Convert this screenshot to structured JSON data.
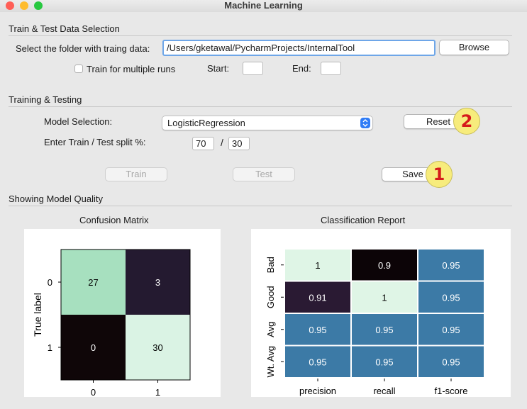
{
  "window": {
    "title": "Machine Learning"
  },
  "data_selection": {
    "section_title": "Train & Test Data Selection",
    "folder_label": "Select the folder with  traing data:",
    "folder_path": "/Users/gketawal/PycharmProjects/InternalTool",
    "browse_label": "Browse",
    "multi_runs_label": "Train for multiple runs",
    "multi_runs_checked": false,
    "start_label": "Start:",
    "start_value": "",
    "end_label": "End:",
    "end_value": ""
  },
  "training": {
    "section_title": "Training &  Testing",
    "model_label": "Model Selection:",
    "model_value": "LogisticRegression",
    "reset_label": "Reset",
    "split_label": "Enter Train / Test split %:",
    "train_split": "70",
    "split_separator": "/",
    "test_split": "30",
    "train_label": "Train",
    "test_label": "Test",
    "save_label": "Save"
  },
  "annotations": {
    "badge_1": "1",
    "badge_2": "2",
    "badge_color": "#f7ec7c",
    "badge_text_color": "#d61b1b"
  },
  "quality": {
    "section_title": "Showing Model Quality",
    "confusion": {
      "title": "Confusion Matrix",
      "ylabel": "True label",
      "row_labels": [
        "0",
        "1"
      ],
      "col_labels": [
        "0",
        "1"
      ],
      "cells": [
        [
          "27",
          "3"
        ],
        [
          "0",
          "30"
        ]
      ]
    },
    "report": {
      "title": "Classification Report",
      "row_labels": [
        "Bad",
        "Good",
        "Avg",
        "Wt. Avg"
      ],
      "col_labels": [
        "precision",
        "recall",
        "f1-score"
      ],
      "cells": [
        [
          "1",
          "0.9",
          "0.95"
        ],
        [
          "0.91",
          "1",
          "0.95"
        ],
        [
          "0.95",
          "0.95",
          "0.95"
        ],
        [
          "0.95",
          "0.95",
          "0.95"
        ]
      ]
    }
  },
  "chart_data": [
    {
      "type": "heatmap",
      "title": "Confusion Matrix",
      "ylabel": "True label",
      "xlabel": "",
      "x": [
        "0",
        "1"
      ],
      "y": [
        "0",
        "1"
      ],
      "values": [
        [
          27,
          3
        ],
        [
          0,
          30
        ]
      ],
      "colors": [
        [
          "#a7e0bf",
          "#241a30"
        ],
        [
          "#0f0608",
          "#daf3e4"
        ]
      ]
    },
    {
      "type": "heatmap",
      "title": "Classification Report",
      "x": [
        "precision",
        "recall",
        "f1-score"
      ],
      "y": [
        "Bad",
        "Good",
        "Avg",
        "Wt. Avg"
      ],
      "values": [
        [
          1,
          0.9,
          0.95
        ],
        [
          0.91,
          1,
          0.95
        ],
        [
          0.95,
          0.95,
          0.95
        ],
        [
          0.95,
          0.95,
          0.95
        ]
      ],
      "colors": [
        [
          "#dff5e6",
          "#0c0407",
          "#3c7aa6"
        ],
        [
          "#2a1a33",
          "#dff5e6",
          "#3c7aa6"
        ],
        [
          "#3c7aa6",
          "#3c7aa6",
          "#3c7aa6"
        ],
        [
          "#3c7aa6",
          "#3c7aa6",
          "#3c7aa6"
        ]
      ]
    }
  ]
}
